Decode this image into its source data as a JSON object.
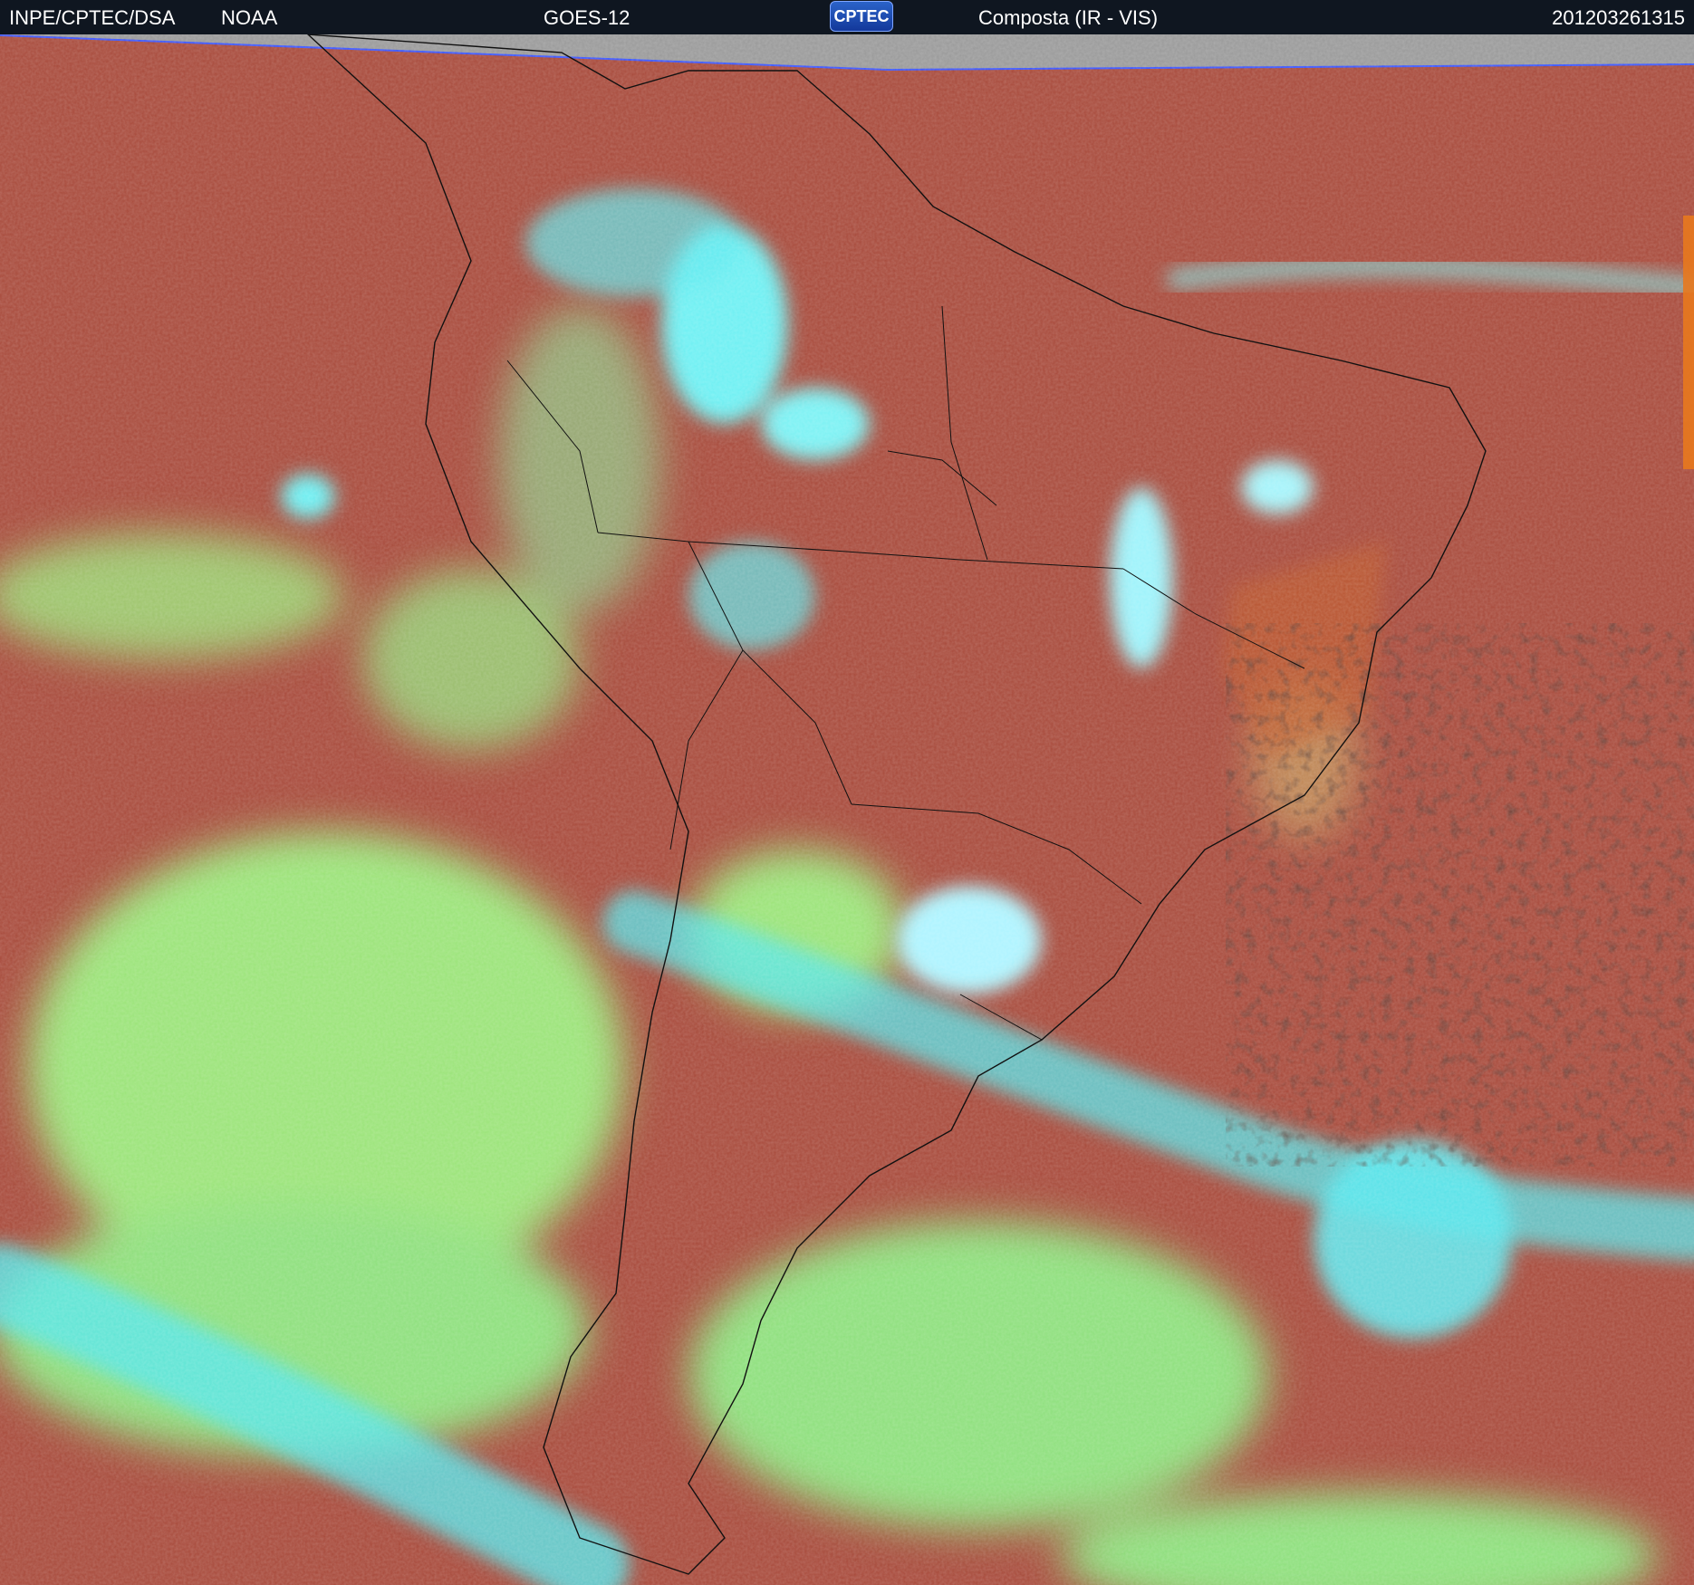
{
  "header": {
    "source": "INPE/CPTEC/DSA",
    "agency": "NOAA",
    "satellite": "GOES-12",
    "logo_text": "CPTEC",
    "product": "Composta (IR - VIS)",
    "timestamp": "201203261315"
  },
  "palette": {
    "header_bg": "#0f1620",
    "clear_surface": "#a84a3b",
    "land_warm": "#c05a2a",
    "low_cloud": "#8fe07a",
    "high_cloud": "#5fe8ee",
    "deep_convection": "#aef4ff",
    "cold_ocean_speckle": "#2a1512",
    "missing_data": "#9a9a9a"
  }
}
